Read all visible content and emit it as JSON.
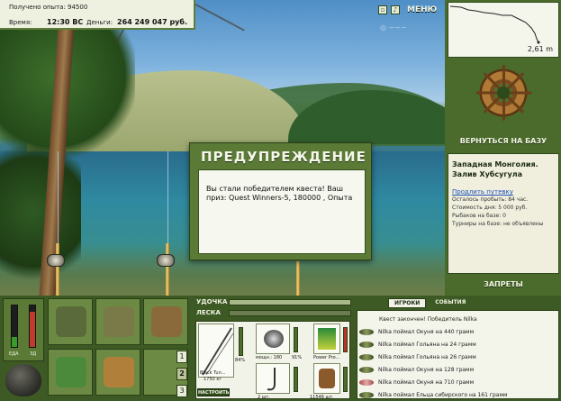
{
  "header": {
    "exp_line": "Получено опыта: 94500",
    "time_label": "Время:",
    "time_value": "12:30 ВС",
    "money_label": "Деньги:",
    "money_value": "264 249 047 руб.",
    "menu_label": "МЕНЮ"
  },
  "depth": {
    "value": "2,61 m"
  },
  "right_panel": {
    "return_label": "ВЕРНУТЬСЯ НА БАЗУ",
    "location_title": "Западная Монголия. Залив Хубсугула",
    "extend_link": "Продлить путевку",
    "stay_left": "Осталось пробыть: 84 час.",
    "day_cost": "Стоимость дня: 5 000 руб.",
    "anglers": "Рыбаков на базе: 0",
    "tournaments": "Турниры на базе: не объявлены",
    "bans_label": "ЗАПРЕТЫ"
  },
  "dialog": {
    "title": "ПРЕДУПРЕЖДЕНИЕ",
    "message": "Вы стали победителем квеста! Ваш приз: Quest Winners-5, 180000 , Опыта"
  },
  "meters": {
    "food_label": "ЕДА",
    "health_label": "ЗД",
    "food_level": 0.25,
    "health_level": 0.85
  },
  "inventory": {
    "page_buttons": [
      "1",
      "2",
      "3"
    ],
    "active_page": "2"
  },
  "gear": {
    "rod_label": "УДОЧКА",
    "line_label": "ЛЕСКА",
    "rod_name": "Black Tun...",
    "rod_weight": "1750 кг",
    "percent_1": "84%",
    "reel_name": "мощн.: 180",
    "percent_2": "91%",
    "line_name": "Power Pro...",
    "hooks_count": "2 шт.",
    "bait_count": "11546 шт.",
    "setup_label": "НАСТРОИТЬ"
  },
  "log": {
    "tab_players": "ИГРОКИ",
    "tab_events": "СОБЫТИЯ",
    "first": "Квест закончен! Победитель Nilka",
    "rows": [
      "Nilka поймал Окуня на 440 грамм",
      "Nilka поймал Гольяна на 24 грамм",
      "Nilka поймал Гольяна на 26 грамм",
      "Nilka поймал Окуня на 128 грамм",
      "Nilka поймал Окуня на 710 грамм",
      "Nilka поймал Ельца сибирского на 161 грамм"
    ]
  },
  "colors": {
    "panel_green": "#4a6b2c",
    "dark_green": "#3d5a24",
    "link_blue": "#1b4fb5"
  }
}
